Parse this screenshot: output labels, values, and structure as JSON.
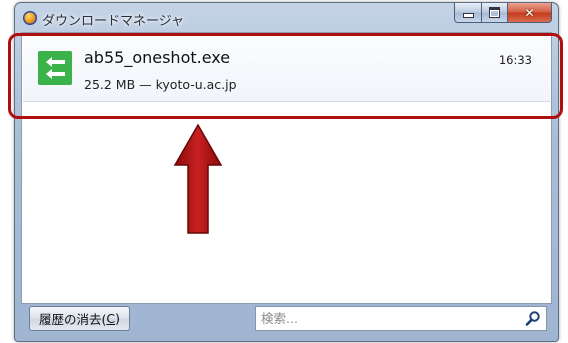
{
  "window": {
    "title": "ダウンロードマネージャ",
    "app_icon": "firefox-icon"
  },
  "window_controls": {
    "minimize": "minimize-icon",
    "maximize": "maximize-icon",
    "close_glyph": "✕"
  },
  "downloads": [
    {
      "filename": "ab55_oneshot.exe",
      "details": "25.2 MB — kyoto-u.ac.jp",
      "time": "16:33",
      "icon": "download-arrows-icon"
    }
  ],
  "footer": {
    "clear_button_prefix": "履歴の消去(",
    "clear_button_accesskey": "C",
    "clear_button_suffix": ")",
    "search_placeholder": "検索...",
    "search_icon": "magnifier-icon"
  },
  "annotation": {
    "highlight_color": "#b00e0e",
    "arrow_color": "#b01010"
  }
}
